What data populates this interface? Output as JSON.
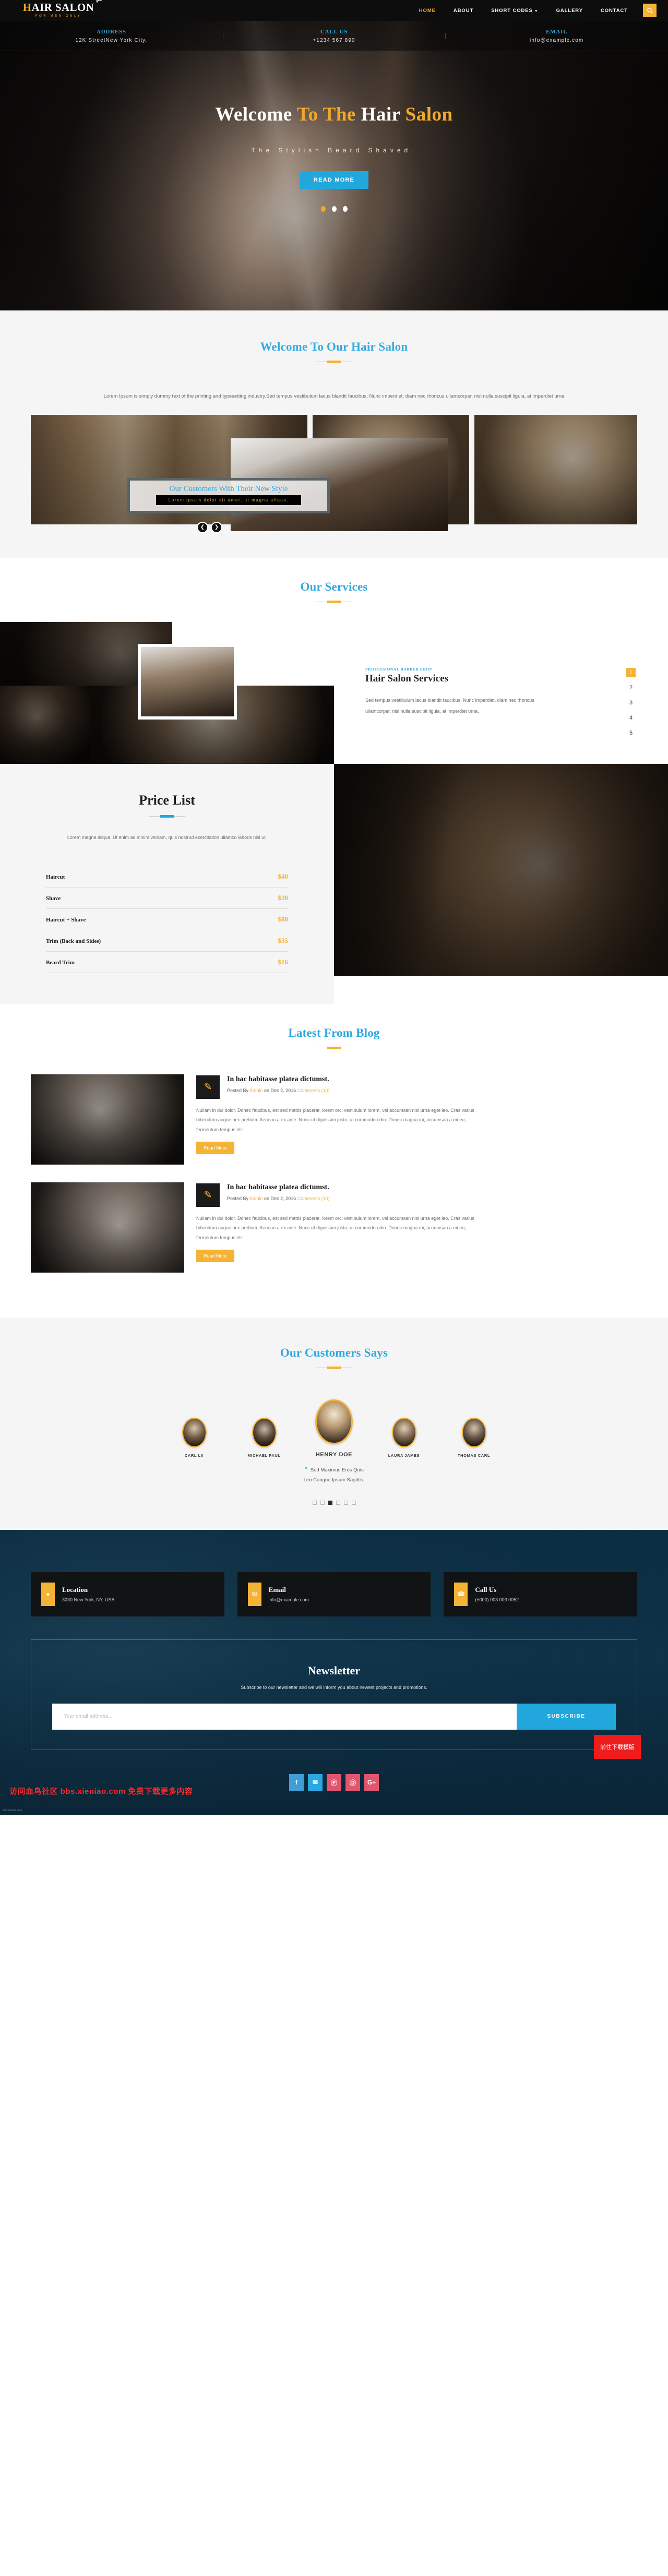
{
  "brand": {
    "name_first": "H",
    "name_rest": "AIR SALON",
    "tagline": "FOR MEN ONLY",
    "scissors_icon": "scissors-icon"
  },
  "nav": {
    "items": [
      {
        "label": "HOME",
        "active": true
      },
      {
        "label": "ABOUT",
        "active": false
      },
      {
        "label": "SHORT CODES",
        "active": false,
        "has_caret": true
      },
      {
        "label": "GALLERY",
        "active": false
      },
      {
        "label": "CONTACT",
        "active": false
      }
    ],
    "search_icon": "search-icon"
  },
  "contact_bar": [
    {
      "title": "ADDRESS",
      "value": "12K StreetNew York City."
    },
    {
      "title": "CALL US",
      "value": "+1234 567 890"
    },
    {
      "title": "EMAIL",
      "value": "info@example.com"
    }
  ],
  "hero": {
    "title_part1": "Welcome ",
    "title_part2": "To The ",
    "title_part3": "Hair ",
    "title_part4": "Salon",
    "subtitle": "The Stylish Beard Shaved.",
    "cta": "READ MORE",
    "slide_count": 3,
    "active_slide": 0
  },
  "welcome": {
    "title": "Welcome To Our Hair Salon",
    "body": "Lorem Ipsum is simply dummy text of the printing and typesetting industry.Sed tempus vestibulum lacus blandit faucibus. Nunc imperdiet, diam nec rhoncus ullamcorper, nisl nulla suscipit ligula, at imperdiet urna"
  },
  "gallery": {
    "overlay_title": "Our Customers With Their New Style",
    "overlay_sub": "Lorem ipsum dolor sit amet, ut magna aliqua.",
    "prev_icon": "chevron-left-icon",
    "next_icon": "chevron-right-icon"
  },
  "services": {
    "section_title": "Our Services",
    "kicker": "PROFESSIONAL BARBER SHOP",
    "title": "Hair Salon Services",
    "body": "Sed tempus vestibulum lacus blandit faucibus. Nunc imperdiet, diam nec rhoncus ullamcorper, nisl nulla suscipit ligula, at imperdiet urna.",
    "numbers": [
      "1",
      "2",
      "3",
      "4",
      "5"
    ],
    "active_number": "1"
  },
  "price": {
    "title": "Price List",
    "body": "Lorem magna aliqua. Ut enim ad minim veniam, quis nostrud exercitation ullamco laboris nisi ut.",
    "items": [
      {
        "name": "Haircut",
        "value": "$40"
      },
      {
        "name": "Shave",
        "value": "$30"
      },
      {
        "name": "Haircut + Shave",
        "value": "$80"
      },
      {
        "name": "Trim (Back and Sides)",
        "value": "$35"
      },
      {
        "name": "Beard Trim",
        "value": "$16"
      }
    ]
  },
  "blog": {
    "section_title": "Latest From Blog",
    "posts": [
      {
        "title": "In hac habitasse platea dictumst.",
        "meta_prefix": "Posted By ",
        "meta_author": "Admin",
        "meta_middle": " on Dec 2, 2016 ",
        "meta_comments": "Comments (10)",
        "text": "Nullam in dui dolor. Donec faucibus, est sed mattis placerat, lorem orci vestibulum lorem, vel accumsan nisl urna eget leo. Cras varius bibendum augue nec pretium. Aenean a ex ante. Nunc ut dignissim justo, ut commodo odio. Donec magna mi, accumsan a mi eu, fermentum tempus elit.",
        "button": "Read More",
        "pencil_icon": "pencil-icon"
      },
      {
        "title": "In hac habitasse platea dictumst.",
        "meta_prefix": "Posted By ",
        "meta_author": "Admin",
        "meta_middle": " on Dec 2, 2016 ",
        "meta_comments": "Comments (10)",
        "text": "Nullam in dui dolor. Donec faucibus, est sed mattis placerat, lorem orci vestibulum lorem, vel accumsan nisl urna eget leo. Cras varius bibendum augue nec pretium. Aenean a ex ante. Nunc ut dignissim justo, ut commodo odio. Donec magna mi, accumsan a mi eu, fermentum tempus elit.",
        "button": "Read More",
        "pencil_icon": "pencil-icon"
      }
    ]
  },
  "testimonials": {
    "section_title": "Our Customers Says",
    "people": [
      {
        "name": "CARL LII",
        "featured": false
      },
      {
        "name": "MICHAEL PAUL",
        "featured": false
      },
      {
        "name": "HENRY DOE",
        "featured": true
      },
      {
        "name": "LAURA JAMES",
        "featured": false
      },
      {
        "name": "THOMAS CARL",
        "featured": false
      }
    ],
    "quote_line1": "Sed Maximus Eros Quis",
    "quote_line2": "Leo Congue Ipsum Sagittis.",
    "dot_count": 6,
    "active_dot": 2
  },
  "footer": {
    "cards": [
      {
        "title": "Location",
        "value": "3030 New York, NY, USA",
        "icon": "map-pin-icon"
      },
      {
        "title": "Email",
        "value": "info@example.com",
        "icon": "envelope-icon"
      },
      {
        "title": "Call Us",
        "value": "(+000) 003 003 0052",
        "icon": "phone-icon"
      }
    ],
    "newsletter": {
      "title": "Newsletter",
      "subtitle": "Subscribe to our newsletter and we will inform you about newest projects and promotions.",
      "placeholder": "Your email address...",
      "value": "",
      "button": "SUBSCRIBE"
    },
    "socials": [
      {
        "glyph": "f",
        "name": "facebook-icon"
      },
      {
        "glyph": "✉",
        "name": "twitter-icon"
      },
      {
        "glyph": "Ⓟ",
        "name": "pinterest-icon"
      },
      {
        "glyph": "Ⓓ",
        "name": "dribbble-icon"
      },
      {
        "glyph": "G+",
        "name": "googleplus-icon"
      }
    ],
    "watermark_left": "访问血鸟社区 bbs.xieniao.com 免费下载更多内容",
    "watermark_button": "前往下载模版",
    "watermark_tiny": "bbs.xieniao.com"
  },
  "colors": {
    "amber": "#f5b335",
    "blue": "#22a7dd",
    "dark": "#111111",
    "light_bg": "#f5f5f5"
  }
}
